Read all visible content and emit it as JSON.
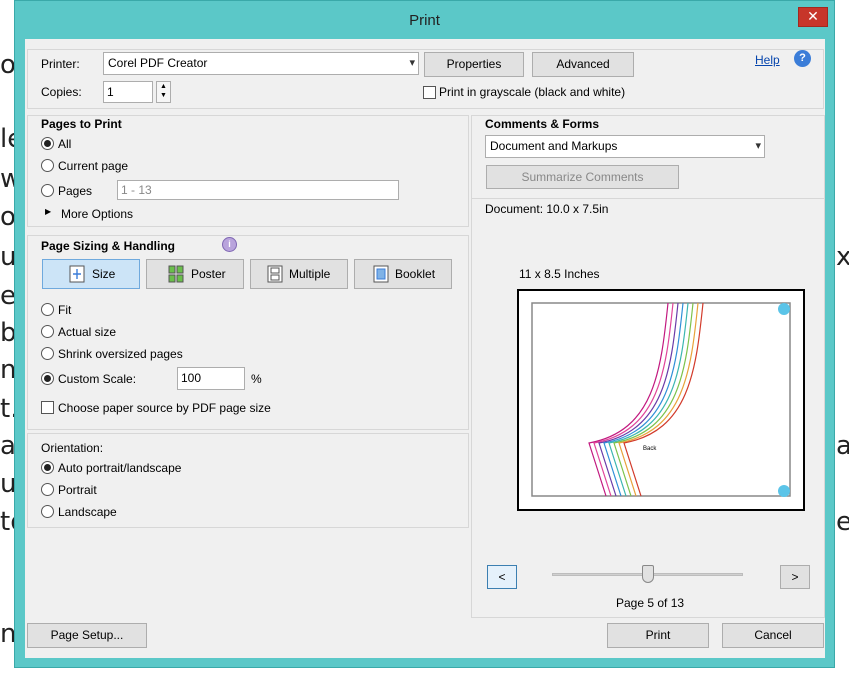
{
  "background_text": [
    "or",
    "le",
    "w",
    "of",
    "u",
    "e",
    "ba",
    "n",
    "t.",
    "a",
    "us",
    "to",
    "nt",
    "x",
    "a",
    "e"
  ],
  "window": {
    "title": "Print",
    "close_glyph": "✕",
    "help_link": "Help",
    "help_icon_glyph": "?"
  },
  "printer": {
    "label": "Printer:",
    "value": "Corel PDF Creator",
    "properties_button": "Properties",
    "advanced_button": "Advanced",
    "copies_label": "Copies:",
    "copies_value": "1",
    "grayscale_label": "Print in grayscale (black and white)",
    "grayscale_checked": false
  },
  "pages_to_print": {
    "heading": "Pages to Print",
    "options": [
      "All",
      "Current page",
      "Pages"
    ],
    "selected": "All",
    "pages_range": "1 - 13",
    "more_options": "More Options"
  },
  "page_sizing": {
    "heading": "Page Sizing & Handling",
    "info_icon": "info-icon",
    "buttons": [
      "Size",
      "Poster",
      "Multiple",
      "Booklet"
    ],
    "active_button": "Size",
    "options": [
      "Fit",
      "Actual size",
      "Shrink oversized pages",
      "Custom Scale:"
    ],
    "selected": "Custom Scale:",
    "custom_scale_value": "100",
    "percent_sign": "%",
    "paper_source_label": "Choose paper source by PDF page size",
    "paper_source_checked": false
  },
  "orientation": {
    "heading": "Orientation:",
    "options": [
      "Auto portrait/landscape",
      "Portrait",
      "Landscape"
    ],
    "selected": "Auto portrait/landscape"
  },
  "comments_forms": {
    "heading": "Comments & Forms",
    "value": "Document and Markups",
    "summarize_button": "Summarize Comments"
  },
  "preview": {
    "document_size": "Document: 10.0 x 7.5in",
    "paper_size": "11 x 8.5 Inches",
    "page_label_text": "Back",
    "prev_glyph": "<",
    "next_glyph": ">",
    "page_indicator": "Page 5 of 13",
    "current_page": 5,
    "total_pages": 13,
    "curve_colors": [
      "#c2187f",
      "#e0449a",
      "#6a3aa8",
      "#2f8fd8",
      "#3ab6b0",
      "#7cc24a",
      "#e8a23a",
      "#d23a2a"
    ],
    "accent_corner_color": "#5bc4e8"
  },
  "footer": {
    "page_setup_button": "Page Setup...",
    "print_button": "Print",
    "cancel_button": "Cancel"
  }
}
